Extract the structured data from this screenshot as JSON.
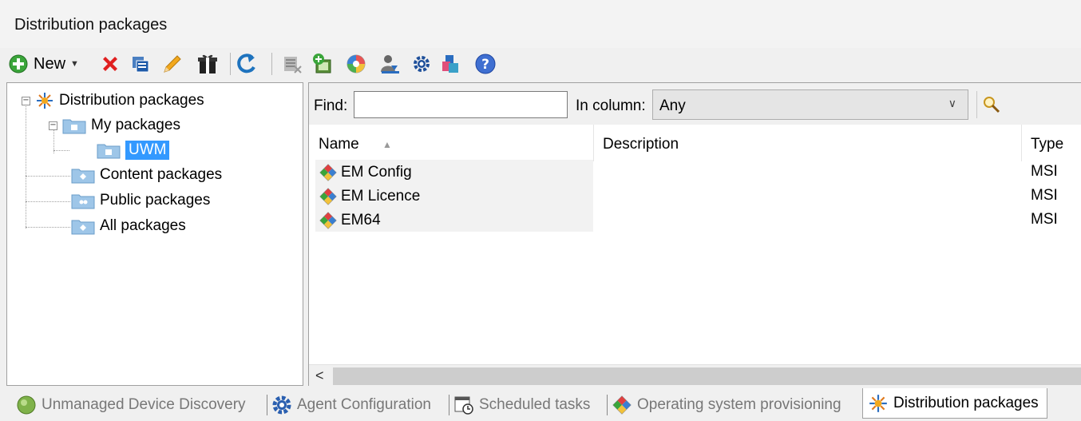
{
  "window": {
    "title": "Distribution packages"
  },
  "toolbar": {
    "new_label": "New",
    "icons": [
      "add-icon",
      "delete-icon",
      "copy-icon",
      "edit-icon",
      "gift-package-icon",
      "refresh-icon",
      "remove-list-icon",
      "add-package-icon",
      "globe-icon",
      "user-assign-icon",
      "settings-icon",
      "apps-icon",
      "help-icon"
    ]
  },
  "tree": {
    "root": "Distribution packages",
    "my_packages": "My packages",
    "uwm": "UWM",
    "content_packages": "Content packages",
    "public_packages": "Public packages",
    "all_packages": "All packages"
  },
  "find": {
    "find_label": "Find:",
    "find_value": "",
    "in_column_label": "In column:",
    "in_column_value": "Any"
  },
  "table": {
    "columns": {
      "name": "Name",
      "description": "Description",
      "type": "Type"
    },
    "rows": [
      {
        "name": "EM Config",
        "description": "",
        "type": "MSI"
      },
      {
        "name": "EM Licence",
        "description": "",
        "type": "MSI"
      },
      {
        "name": "EM64",
        "description": "",
        "type": "MSI"
      }
    ]
  },
  "tabs": [
    {
      "label": "Unmanaged Device Discovery",
      "active": false
    },
    {
      "label": "Agent Configuration",
      "active": false
    },
    {
      "label": "Scheduled tasks",
      "active": false
    },
    {
      "label": "Operating system provisioning",
      "active": false
    },
    {
      "label": "Distribution packages",
      "active": true
    }
  ],
  "colors": {
    "selection": "#3399ff",
    "accent_blue": "#1e73be"
  }
}
